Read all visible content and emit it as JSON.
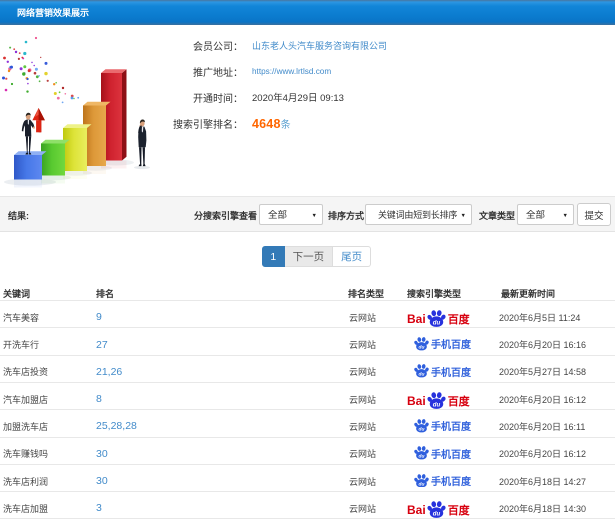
{
  "header": {
    "title": "网络营销效果展示"
  },
  "info": {
    "company_label": "会员公司：",
    "company_value": "山东老人头汽车服务咨询有限公司",
    "url_label": "推广地址：",
    "url_value": "https://www.lrtlsd.com",
    "open_time_label": "开通时间：",
    "open_time_value": "2020年4月29日 09:13",
    "rank_label": "搜索引擎排名：",
    "rank_count": "4648",
    "rank_unit": "条"
  },
  "filters": {
    "result_label": "结果:",
    "engine_label": "分搜索引擎查看",
    "engine_value": "全部",
    "sort_label": "排序方式",
    "sort_value": "关键词由短到长排序",
    "article_label": "文章类型",
    "article_value": "全部",
    "submit_label": "提交"
  },
  "pagination": {
    "current": "1",
    "next": "下一页",
    "last": "尾页"
  },
  "table": {
    "headers": [
      "关键词",
      "排名",
      "排名类型",
      "搜索引擎类型",
      "最新更新时间"
    ],
    "rows": [
      {
        "keyword": "汽车美容",
        "rank": "9",
        "rank_type": "云网站",
        "engine": "baidu",
        "engine_text": "百度",
        "updated": "2020年6月5日 11:24"
      },
      {
        "keyword": "开洗车行",
        "rank": "27",
        "rank_type": "云网站",
        "engine": "mobile",
        "engine_text": "手机百度",
        "updated": "2020年6月20日 16:16"
      },
      {
        "keyword": "洗车店投资",
        "rank": "21,26",
        "rank_type": "云网站",
        "engine": "mobile",
        "engine_text": "手机百度",
        "updated": "2020年5月27日 14:58"
      },
      {
        "keyword": "汽车加盟店",
        "rank": "8",
        "rank_type": "云网站",
        "engine": "baidu",
        "engine_text": "百度",
        "updated": "2020年6月20日 16:12"
      },
      {
        "keyword": "加盟洗车店",
        "rank": "25,28,28",
        "rank_type": "云网站",
        "engine": "mobile",
        "engine_text": "手机百度",
        "updated": "2020年6月20日 16:11"
      },
      {
        "keyword": "洗车赚钱吗",
        "rank": "30",
        "rank_type": "云网站",
        "engine": "mobile",
        "engine_text": "手机百度",
        "updated": "2020年6月20日 16:12"
      },
      {
        "keyword": "洗车店利润",
        "rank": "30",
        "rank_type": "云网站",
        "engine": "mobile",
        "engine_text": "手机百度",
        "updated": "2020年6月18日 14:27"
      },
      {
        "keyword": "洗车店加盟",
        "rank": "3",
        "rank_type": "云网站",
        "engine": "baidu",
        "engine_text": "百度",
        "updated": "2020年6月18日 14:30"
      }
    ]
  },
  "logos": {
    "baidu_latin": "Bai",
    "baidu_paw_text": "du"
  },
  "colors": {
    "header_blue": "#0b7ccf",
    "link_blue": "#428bca",
    "rank_orange": "#ff6600",
    "pager_active": "#337ab7",
    "baidu_red": "#d7000f",
    "baidu_blue": "#2732dd"
  }
}
